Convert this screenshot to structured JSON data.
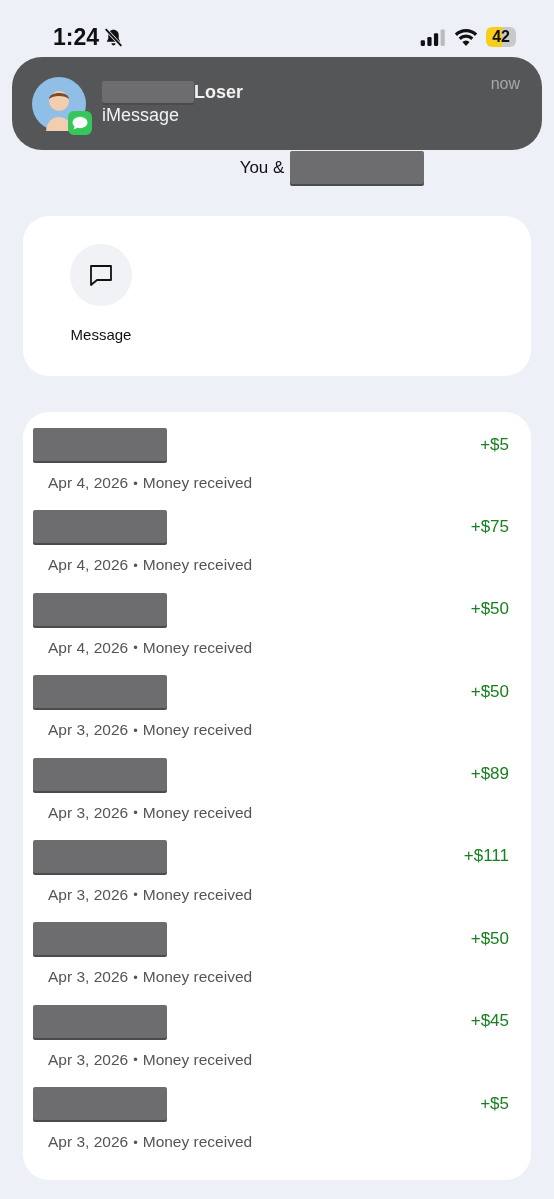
{
  "status_bar": {
    "time": "1:24",
    "silenced": true,
    "battery": "42",
    "low_power_mode": true
  },
  "notification": {
    "sender": "Loser",
    "app": "iMessage",
    "time": "now"
  },
  "header": {
    "title": "You &"
  },
  "actions": [
    {
      "label": "Message"
    }
  ],
  "separator": "•",
  "transactions": [
    {
      "date": "Apr 4, 2026",
      "description": "Money received",
      "amount": "+$5"
    },
    {
      "date": "Apr 4, 2026",
      "description": "Money received",
      "amount": "+$75"
    },
    {
      "date": "Apr 4, 2026",
      "description": "Money received",
      "amount": "+$50"
    },
    {
      "date": "Apr 3, 2026",
      "description": "Money received",
      "amount": "+$50"
    },
    {
      "date": "Apr 3, 2026",
      "description": "Money received",
      "amount": "+$89"
    },
    {
      "date": "Apr 3, 2026",
      "description": "Money received",
      "amount": "+$111"
    },
    {
      "date": "Apr 3, 2026",
      "description": "Money received",
      "amount": "+$50"
    },
    {
      "date": "Apr 3, 2026",
      "description": "Money received",
      "amount": "+$45"
    },
    {
      "date": "Apr 3, 2026",
      "description": "Money received",
      "amount": "+$5"
    }
  ]
}
